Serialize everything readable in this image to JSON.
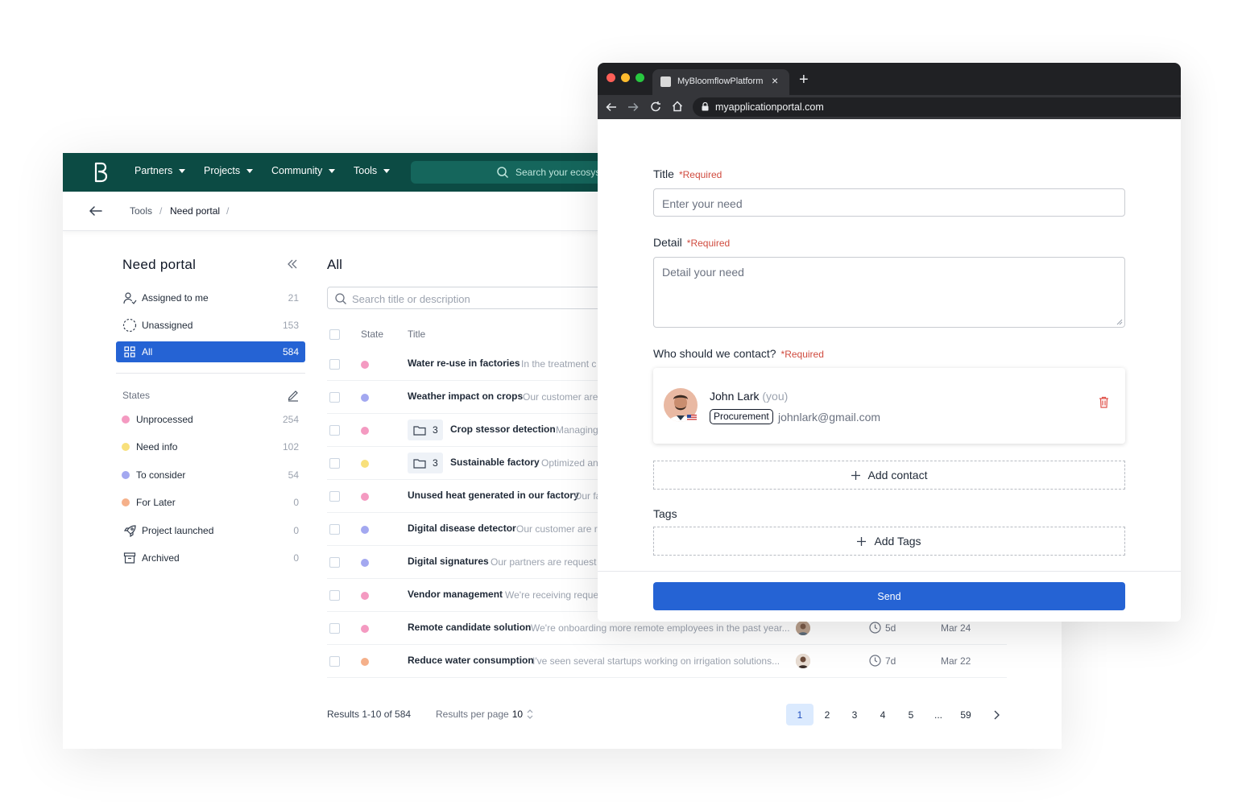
{
  "nav": {
    "items": [
      "Partners",
      "Projects",
      "Community",
      "Tools"
    ],
    "search_placeholder": "Search your ecosys"
  },
  "breadcrumb": [
    "Tools",
    "Need portal"
  ],
  "sidebar": {
    "title": "Need portal",
    "views": [
      {
        "label": "Assigned to me",
        "count": "21",
        "icon": "user-check-icon"
      },
      {
        "label": "Unassigned",
        "count": "153",
        "icon": "dashed-circle-icon"
      },
      {
        "label": "All",
        "count": "584",
        "icon": "grid-icon",
        "active": true
      }
    ],
    "states_label": "States",
    "states": [
      {
        "label": "Unprocessed",
        "count": "254",
        "color": "#f49ac1"
      },
      {
        "label": "Need info",
        "count": "102",
        "color": "#f8e07b"
      },
      {
        "label": "To consider",
        "count": "54",
        "color": "#a3a8f0"
      },
      {
        "label": "For Later",
        "count": "0",
        "color": "#f5b08a"
      }
    ],
    "extra": [
      {
        "label": "Project launched",
        "count": "0",
        "icon": "rocket-icon"
      },
      {
        "label": "Archived",
        "count": "0",
        "icon": "archive-icon"
      }
    ]
  },
  "main": {
    "title": "All",
    "search_placeholder": "Search title or description",
    "columns": [
      "State",
      "Title"
    ],
    "rows": [
      {
        "title": "Water re-use in factories",
        "desc": "In the treatment c",
        "color": "#f49ac1"
      },
      {
        "title": "Weather impact on crops",
        "desc": "Our customer are",
        "color": "#a3a8f0"
      },
      {
        "title": "Crop stessor detection",
        "desc": "Managing",
        "color": "#f49ac1",
        "folder": "3"
      },
      {
        "title": "Sustainable factory",
        "desc": "Optimized an",
        "color": "#f8e07b",
        "folder": "3"
      },
      {
        "title": "Unused heat generated in our factory",
        "desc": "Our fa",
        "color": "#f49ac1"
      },
      {
        "title": "Digital disease detector",
        "desc": "Our customer are r",
        "color": "#a3a8f0"
      },
      {
        "title": "Digital signatures",
        "desc": "Our partners are request",
        "color": "#a3a8f0"
      },
      {
        "title": "Vendor management",
        "desc": "We're receiving reque",
        "color": "#f49ac1"
      },
      {
        "title": "Remote candidate solution",
        "desc": "We're onboarding more remote employees in the past year...",
        "color": "#f49ac1",
        "age": "5d",
        "date": "Mar 24"
      },
      {
        "title": "Reduce water consumption",
        "desc": "I've seen several startups working on irrigation solutions...",
        "color": "#f5b08a",
        "age": "7d",
        "date": "Mar 22"
      }
    ],
    "results": "Results 1-10 of 584",
    "per_page_label": "Results per page",
    "per_page_value": "10",
    "pages": [
      "1",
      "2",
      "3",
      "4",
      "5",
      "...",
      "59"
    ],
    "current_page": "1"
  },
  "browser": {
    "tab_title": "MyBloomflowPlatform",
    "url": "myapplicationportal.com"
  },
  "form": {
    "title_label": "Title",
    "required": "*Required",
    "title_placeholder": "Enter your need",
    "detail_label": "Detail",
    "detail_placeholder": "Detail your need",
    "contact_label": "Who should we contact?",
    "contact": {
      "name": "John Lark",
      "you": "(you)",
      "tag": "Procurement",
      "email": "johnlark@gmail.com"
    },
    "add_contact": "Add contact",
    "tags_label": "Tags",
    "add_tags": "Add Tags",
    "send": "Send"
  }
}
